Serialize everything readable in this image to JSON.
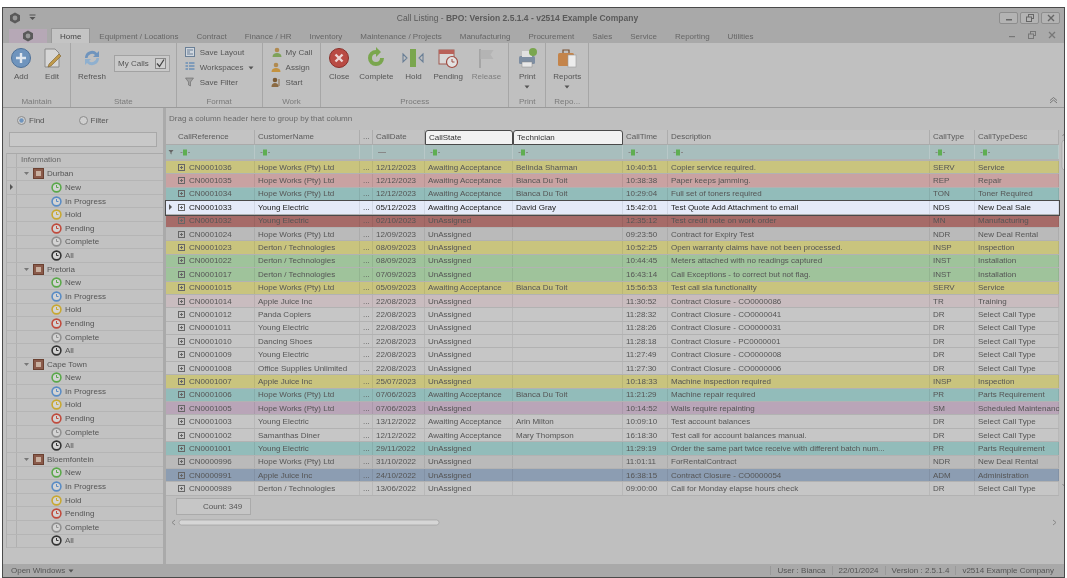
{
  "window": {
    "title": "Call Listing - **BPO: Version 2.5.1.4 - v2514 Example Company**"
  },
  "tabs": [
    {
      "label": "Home",
      "selected": true
    },
    {
      "label": "Equipment / Locations",
      "selected": false
    },
    {
      "label": "Contract",
      "selected": false
    },
    {
      "label": "Finance / HR",
      "selected": false
    },
    {
      "label": "Inventory",
      "selected": false
    },
    {
      "label": "Maintenance / Projects",
      "selected": false
    },
    {
      "label": "Manufacturing",
      "selected": false
    },
    {
      "label": "Procurement",
      "selected": false
    },
    {
      "label": "Sales",
      "selected": false
    },
    {
      "label": "Service",
      "selected": false
    },
    {
      "label": "Reporting",
      "selected": false
    },
    {
      "label": "Utilities",
      "selected": false
    }
  ],
  "ribbon": {
    "groups": [
      {
        "label": "Maintain",
        "items": [
          {
            "kind": "large",
            "label": "Add",
            "disabled": false,
            "dropdown": false
          },
          {
            "kind": "large",
            "label": "Edit",
            "disabled": false,
            "dropdown": false
          }
        ]
      },
      {
        "label": "State",
        "items": [
          {
            "kind": "large",
            "label": "Refresh",
            "disabled": false,
            "dropdown": false
          },
          {
            "kind": "check",
            "label": "My Calls",
            "checked": true,
            "disabled": false
          }
        ]
      },
      {
        "label": "Format",
        "items": [
          {
            "kind": "small",
            "label": "Save Layout",
            "disabled": false,
            "dropdown": false
          },
          {
            "kind": "small",
            "label": "Workspaces",
            "disabled": false,
            "dropdown": true
          },
          {
            "kind": "small",
            "label": "Save Filter",
            "disabled": false,
            "dropdown": false
          }
        ]
      },
      {
        "label": "Work",
        "items": [
          {
            "kind": "small",
            "label": "My Call",
            "disabled": false,
            "dropdown": false
          },
          {
            "kind": "small",
            "label": "Assign",
            "disabled": false,
            "dropdown": false
          },
          {
            "kind": "small",
            "label": "Start",
            "disabled": false,
            "dropdown": false
          }
        ]
      },
      {
        "label": "Process",
        "items": [
          {
            "kind": "large",
            "label": "Close",
            "disabled": false,
            "dropdown": false
          },
          {
            "kind": "large",
            "label": "Complete",
            "disabled": false,
            "dropdown": false
          },
          {
            "kind": "large",
            "label": "Hold",
            "disabled": false,
            "dropdown": false
          },
          {
            "kind": "large",
            "label": "Pending",
            "disabled": false,
            "dropdown": false
          },
          {
            "kind": "large",
            "label": "Release",
            "disabled": true,
            "dropdown": false
          }
        ]
      },
      {
        "label": "Print",
        "items": [
          {
            "kind": "large",
            "label": "Print",
            "disabled": false,
            "dropdown": true
          }
        ]
      },
      {
        "label": "Repo...",
        "items": [
          {
            "kind": "large",
            "label": "Reports",
            "disabled": false,
            "dropdown": true
          }
        ]
      }
    ]
  },
  "side_panel": {
    "modes": [
      {
        "label": "Find",
        "selected": true
      },
      {
        "label": "Filter",
        "selected": false
      }
    ],
    "tree": {
      "header": "Information",
      "nodes": [
        {
          "label": "Durban",
          "expanded": true,
          "selected": false,
          "children": [
            {
              "label": "New",
              "color": "#5aa84a",
              "selected": true
            },
            {
              "label": "In Progress",
              "color": "#5a8cc4",
              "selected": false
            },
            {
              "label": "Hold",
              "color": "#c8a832",
              "selected": false
            },
            {
              "label": "Pending",
              "color": "#c04a3c",
              "selected": false
            },
            {
              "label": "Complete",
              "color": "#909090",
              "selected": false
            },
            {
              "label": "All",
              "color": "#333333",
              "selected": false
            }
          ]
        },
        {
          "label": "Pretoria",
          "expanded": true,
          "selected": false,
          "children": [
            {
              "label": "New",
              "color": "#5aa84a",
              "selected": false
            },
            {
              "label": "In Progress",
              "color": "#5a8cc4",
              "selected": false
            },
            {
              "label": "Hold",
              "color": "#c8a832",
              "selected": false
            },
            {
              "label": "Pending",
              "color": "#c04a3c",
              "selected": false
            },
            {
              "label": "Complete",
              "color": "#909090",
              "selected": false
            },
            {
              "label": "All",
              "color": "#333333",
              "selected": false
            }
          ]
        },
        {
          "label": "Cape Town",
          "expanded": true,
          "selected": false,
          "children": [
            {
              "label": "New",
              "color": "#5aa84a",
              "selected": false
            },
            {
              "label": "In Progress",
              "color": "#5a8cc4",
              "selected": false
            },
            {
              "label": "Hold",
              "color": "#c8a832",
              "selected": false
            },
            {
              "label": "Pending",
              "color": "#c04a3c",
              "selected": false
            },
            {
              "label": "Complete",
              "color": "#909090",
              "selected": false
            },
            {
              "label": "All",
              "color": "#333333",
              "selected": false
            }
          ]
        },
        {
          "label": "Bloemfontein",
          "expanded": true,
          "selected": false,
          "children": [
            {
              "label": "New",
              "color": "#5aa84a",
              "selected": false
            },
            {
              "label": "In Progress",
              "color": "#5a8cc4",
              "selected": false
            },
            {
              "label": "Hold",
              "color": "#c8a832",
              "selected": false
            },
            {
              "label": "Pending",
              "color": "#c04a3c",
              "selected": false
            },
            {
              "label": "Complete",
              "color": "#909090",
              "selected": false
            },
            {
              "label": "All",
              "color": "#333333",
              "selected": false
            }
          ]
        }
      ]
    }
  },
  "grid": {
    "group_hint": "Drag a column header here to group by that column",
    "columns": [
      {
        "label": "CallReference",
        "kind": "text",
        "highlighted": false
      },
      {
        "label": "CustomerName",
        "kind": "text",
        "highlighted": false
      },
      {
        "label": "...",
        "kind": "more",
        "highlighted": false
      },
      {
        "label": "CallDate",
        "kind": "date",
        "highlighted": false
      },
      {
        "label": "CallState",
        "kind": "text",
        "highlighted": true
      },
      {
        "label": "Technician",
        "kind": "text",
        "highlighted": true
      },
      {
        "label": "CallTime",
        "kind": "text",
        "highlighted": false
      },
      {
        "label": "Description",
        "kind": "text",
        "highlighted": false
      },
      {
        "label": "CallType",
        "kind": "text",
        "highlighted": false
      },
      {
        "label": "CallTypeDesc",
        "kind": "text",
        "highlighted": false
      }
    ],
    "rows": [
      {
        "cells": [
          "CN0001036",
          "Hope Works (Pty) Ltd",
          "...",
          "12/12/2023",
          "Awaiting Acceptance",
          "Belinda Sharman",
          "10:40:51",
          "Copier service required.",
          "SERV",
          "Service"
        ],
        "color": "#c9c47e",
        "selected": false
      },
      {
        "cells": [
          "CN0001035",
          "Hope Works (Pty) Ltd",
          "...",
          "12/12/2023",
          "Awaiting Acceptance",
          "Bianca Du Toit",
          "10:38:38",
          "Paper keeps jamming.",
          "REP",
          "Repair"
        ],
        "color": "#c9a2a2",
        "selected": false
      },
      {
        "cells": [
          "CN0001034",
          "Hope Works (Pty) Ltd",
          "...",
          "12/12/2023",
          "Awaiting Acceptance",
          "Bianca Du Toit",
          "10:29:04",
          "Full set of toners required",
          "TON",
          "Toner Required"
        ],
        "color": "#92bcba",
        "selected": false
      },
      {
        "cells": [
          "CN0001033",
          "Young Electric",
          "...",
          "05/12/2023",
          "Awaiting Acceptance",
          "David Gray",
          "15:42:01",
          "Test Quote Add Attachment to email",
          "NDS",
          "New Deal Sale"
        ],
        "selected": true
      },
      {
        "cells": [
          "CN0001032",
          "Young Electric",
          "...",
          "02/10/2023",
          "UnAssigned",
          null,
          "12:35:12",
          "Test credit note on work order",
          "MN",
          "Manufacturing"
        ],
        "color": "#a66b68",
        "selected": false
      },
      {
        "cells": [
          "CN0001024",
          "Hope Works (Pty) Ltd",
          "...",
          "12/09/2023",
          "UnAssigned",
          null,
          "09:23:50",
          "Contract for Expiry Test",
          "NDR",
          "New Deal Rental"
        ],
        "color": "#bababa",
        "selected": false
      },
      {
        "cells": [
          "CN0001023",
          "Derton / Technologies",
          "...",
          "08/09/2023",
          "UnAssigned",
          null,
          "10:52:25",
          "Open warranty claims have not been processed.",
          "INSP",
          "Inspection"
        ],
        "color": "#c9c47e",
        "selected": false
      },
      {
        "cells": [
          "CN0001022",
          "Derton / Technologies",
          "...",
          "08/09/2023",
          "UnAssigned",
          null,
          "10:44:45",
          "Meters attached with no readings captured",
          "INST",
          "Installation"
        ],
        "color": "#9fc39b",
        "selected": false
      },
      {
        "cells": [
          "CN0001017",
          "Derton / Technologies",
          "...",
          "07/09/2023",
          "UnAssigned",
          null,
          "16:43:14",
          "Call Exceptions - to correct but not flag.",
          "INST",
          "Installation"
        ],
        "color": "#9fc39b",
        "selected": false
      },
      {
        "cells": [
          "CN0001015",
          "Hope Works (Pty) Ltd",
          "...",
          "05/09/2023",
          "Awaiting Acceptance",
          "Bianca Du Toit",
          "15:56:53",
          "Test call sla functionality",
          "SERV",
          "Service"
        ],
        "color": "#c9c47e",
        "selected": false
      },
      {
        "cells": [
          "CN0001014",
          "Apple Juice Inc",
          "...",
          "22/08/2023",
          "UnAssigned",
          null,
          "11:30:52",
          "Contract Closure - CO0000086",
          "TR",
          "Training"
        ],
        "color": "#c9bcbf",
        "selected": false
      },
      {
        "cells": [
          "CN0001012",
          "Panda Copiers",
          "...",
          "22/08/2023",
          "UnAssigned",
          null,
          "11:28:32",
          "Contract Closure - CO0000041",
          "DR",
          "Select Call Type"
        ],
        "color": "#c6c6c6",
        "selected": false
      },
      {
        "cells": [
          "CN0001011",
          "Young Electric",
          "...",
          "22/08/2023",
          "UnAssigned",
          null,
          "11:28:26",
          "Contract Closure - CO0000031",
          "DR",
          "Select Call Type"
        ],
        "color": "#c6c6c6",
        "selected": false
      },
      {
        "cells": [
          "CN0001010",
          "Dancing Shoes",
          "...",
          "22/08/2023",
          "UnAssigned",
          null,
          "11:28:18",
          "Contract Closure - PC0000001",
          "DR",
          "Select Call Type"
        ],
        "color": "#c6c6c6",
        "selected": false
      },
      {
        "cells": [
          "CN0001009",
          "Young Electric",
          "...",
          "22/08/2023",
          "UnAssigned",
          null,
          "11:27:49",
          "Contract Closure - CO0000008",
          "DR",
          "Select Call Type"
        ],
        "color": "#c6c6c6",
        "selected": false
      },
      {
        "cells": [
          "CN0001008",
          "Office Supplies Unlimited",
          "...",
          "22/08/2023",
          "UnAssigned",
          null,
          "11:27:30",
          "Contract Closure - CO0000006",
          "DR",
          "Select Call Type"
        ],
        "color": "#c6c6c6",
        "selected": false
      },
      {
        "cells": [
          "CN0001007",
          "Apple Juice Inc",
          "...",
          "25/07/2023",
          "UnAssigned",
          null,
          "10:18:33",
          "Machine inspection required",
          "INSP",
          "Inspection"
        ],
        "color": "#c9c47e",
        "selected": false
      },
      {
        "cells": [
          "CN0001006",
          "Hope Works (Pty) Ltd",
          "...",
          "07/06/2023",
          "Awaiting Acceptance",
          "Bianca Du Toit",
          "11:21:29",
          "Machine repair required",
          "PR",
          "Parts Requirement"
        ],
        "color": "#92bcba",
        "selected": false
      },
      {
        "cells": [
          "CN0001005",
          "Hope Works (Pty) Ltd",
          "...",
          "07/06/2023",
          "UnAssigned",
          null,
          "10:14:52",
          "Walls require repainting",
          "SM",
          "Scheduled Maintenanc"
        ],
        "color": "#b9a5b8",
        "selected": false
      },
      {
        "cells": [
          "CN0001003",
          "Young Electric",
          "...",
          "13/12/2022",
          "Awaiting Acceptance",
          "Arin Milton",
          "10:09:10",
          "Test account balances",
          "DR",
          "Select Call Type"
        ],
        "color": "#c6c6c6",
        "selected": false
      },
      {
        "cells": [
          "CN0001002",
          "Samanthas Diner",
          "...",
          "12/12/2022",
          "Awaiting Acceptance",
          "Mary Thompson",
          "16:18:30",
          "Test call for account balances manual.",
          "DR",
          "Select Call Type"
        ],
        "color": "#c6c6c6",
        "selected": false
      },
      {
        "cells": [
          "CN0001001",
          "Young Electric",
          "...",
          "29/11/2022",
          "UnAssigned",
          null,
          "11:29:19",
          "Order the same part twice receive with different batch num...",
          "PR",
          "Parts Requirement"
        ],
        "color": "#92bcba",
        "selected": false
      },
      {
        "cells": [
          "CN0000996",
          "Hope Works (Pty) Ltd",
          "...",
          "31/10/2022",
          "UnAssigned",
          null,
          "11:01:11",
          "ForRentalContract",
          "NDR",
          "New Deal Rental"
        ],
        "color": "#bababa",
        "selected": false
      },
      {
        "cells": [
          "CN0000991",
          "Apple Juice Inc",
          "...",
          "24/10/2022",
          "UnAssigned",
          null,
          "16:38:15",
          "Contract Closure - CO0000054",
          "ADM",
          "Administration"
        ],
        "color": "#8c9db2",
        "selected": false
      },
      {
        "cells": [
          "CN0000989",
          "Derton / Technologies",
          "...",
          "13/06/2022",
          "UnAssigned",
          null,
          "09:00:00",
          "Call for Monday elapse hours check",
          "DR",
          "Select Call Type"
        ],
        "color": "#c6c6c6",
        "selected": false
      }
    ],
    "count": "Count: 349"
  },
  "status_bar": {
    "open_windows": "Open Windows",
    "items": [
      "User : Bianca",
      "22/01/2024",
      "Version : 2.5.1.4",
      "v2514 Example Company"
    ]
  }
}
